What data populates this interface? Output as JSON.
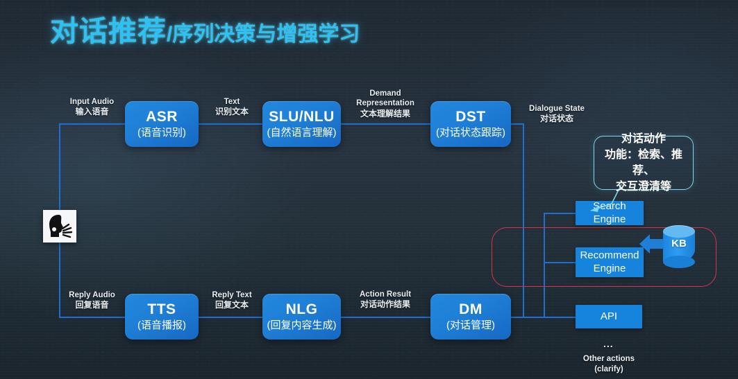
{
  "slide": {
    "title_main": "对话推荐",
    "title_sub": "/序列决策与增强学习",
    "accent_color": "#2ec2f2",
    "box_color": "#1f7fd6",
    "line_color": "#1f6fd0",
    "group_color": "#d9334a",
    "callout_border_color": "#7fd8ef"
  },
  "icons": {
    "speaking_person": "speaking-person-icon",
    "kb_database": "database-cylinder-icon",
    "feed_arrow": "left-block-arrow-icon"
  },
  "top_pipeline": {
    "boxes": [
      {
        "en": "ASR",
        "cn": "(语音识别)"
      },
      {
        "en": "SLU/NLU",
        "cn": "(自然语言理解)"
      },
      {
        "en": "DST",
        "cn": "(对话状态跟踪)"
      }
    ],
    "labels": [
      {
        "en": "Input Audio",
        "cn": "输入语音"
      },
      {
        "en": "Text",
        "cn": "识别文本"
      },
      {
        "en": "Demand\nRepresentation",
        "en_l1": "Demand",
        "en_l2": "Representation",
        "cn": "文本理解结果"
      },
      {
        "en": "Dialogue State",
        "cn": "对话状态"
      }
    ]
  },
  "bottom_pipeline": {
    "boxes": [
      {
        "en": "TTS",
        "cn": "(语音播报)"
      },
      {
        "en": "NLG",
        "cn": "(回复内容生成)"
      },
      {
        "en": "DM",
        "cn": "(对话管理)"
      }
    ],
    "labels": [
      {
        "en": "Reply Audio",
        "cn": "回复语音"
      },
      {
        "en": "Reply Text",
        "cn": "回复文本"
      },
      {
        "en": "Action Result",
        "cn": "对话动作结果"
      }
    ]
  },
  "callout": {
    "line1": "对话动作",
    "line2": "功能：检索、推荐、",
    "line3": "交互澄清等"
  },
  "actions": {
    "search_engine": "Search Engine",
    "recommend_engine_l1": "Recommend",
    "recommend_engine_l2": "Engine",
    "api": "API",
    "ellipsis": "...",
    "other_actions_l1": "Other actions",
    "other_actions_l2": "(clarify)"
  },
  "knowledge_base": {
    "label": "KB"
  }
}
